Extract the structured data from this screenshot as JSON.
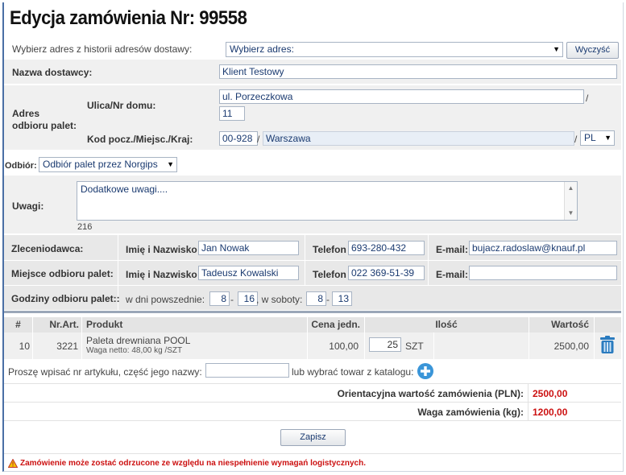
{
  "page": {
    "title": "Edycja zamówienia Nr: 99558"
  },
  "address_history": {
    "label": "Wybierz adres z historii adresów dostawy:",
    "select_value": "Wybierz adres:",
    "clear_button": "Wyczyść"
  },
  "supplier": {
    "label": "Nazwa dostawcy:",
    "value": "Klient Testowy"
  },
  "pickup_address": {
    "label": "Adres odbioru palet:",
    "street_label": "Ulica/Nr domu:",
    "street_value": "ul. Porzeczkowa",
    "slash": "/",
    "house_value": "11",
    "postal_label": "Kod pocz./Miejsc./Kraj:",
    "postal_value": "00-928",
    "city_value": "Warszawa",
    "country_value": "PL"
  },
  "pickup_type": {
    "label": "Odbiór:",
    "value": "Odbiór palet przez Norgips"
  },
  "notes": {
    "label": "Uwagi:",
    "value": "Dodatkowe uwagi....",
    "counter": "216"
  },
  "orderer": {
    "label": "Zleceniodawca:",
    "name_label": "Imię i Nazwisko",
    "name_value": "Jan Nowak",
    "phone_label": "Telefon",
    "phone_value": "693-280-432",
    "email_label": "E-mail:",
    "email_value": "bujacz.radoslaw@knauf.pl"
  },
  "pickup_place": {
    "label": "Miejsce odbioru palet:",
    "name_label": "Imię i Nazwisko",
    "name_value": "Tadeusz Kowalski",
    "phone_label": "Telefon",
    "phone_value": "022 369-51-39",
    "email_label": "E-mail:",
    "email_value": ""
  },
  "pickup_hours": {
    "label": "Godziny odbioru palet::",
    "weekdays_label": "w dni powszednie:",
    "weekdays_from": "8",
    "weekdays_to": "16",
    "dash": "-",
    "saturday_label": ", w soboty:",
    "saturday_from": "8",
    "saturday_to": "13"
  },
  "table": {
    "headers": {
      "num": "#",
      "art": "Nr.Art.",
      "product": "Produkt",
      "price": "Cena jedn.",
      "qty": "Ilość",
      "value": "Wartość"
    },
    "rows": [
      {
        "num": "10",
        "art": "3221",
        "product": "Paleta drewniana POOL",
        "weight": "Waga netto: 48,00 kg /SZT",
        "price": "100,00",
        "qty": "25",
        "unit": "SZT",
        "value": "2500,00"
      }
    ]
  },
  "search": {
    "label": "Proszę wpisać nr artykułu, część jego nazwy:",
    "value": "",
    "catalog_label": "lub wybrać towar z katalogu:"
  },
  "summary": {
    "value_label": "Orientacyjna wartość zamówienia (PLN):",
    "value": "2500,00",
    "weight_label": "Waga zamówienia (kg):",
    "weight": "1200,00"
  },
  "actions": {
    "save": "Zapisz"
  },
  "warning": {
    "text": "Zamówienie może zostać odrzucone ze względu na niespełnienie wymagań logistycznych."
  },
  "colors": {
    "accent": "#4a6fa5",
    "warning": "#cc1111",
    "trash": "#2a7bbf"
  }
}
